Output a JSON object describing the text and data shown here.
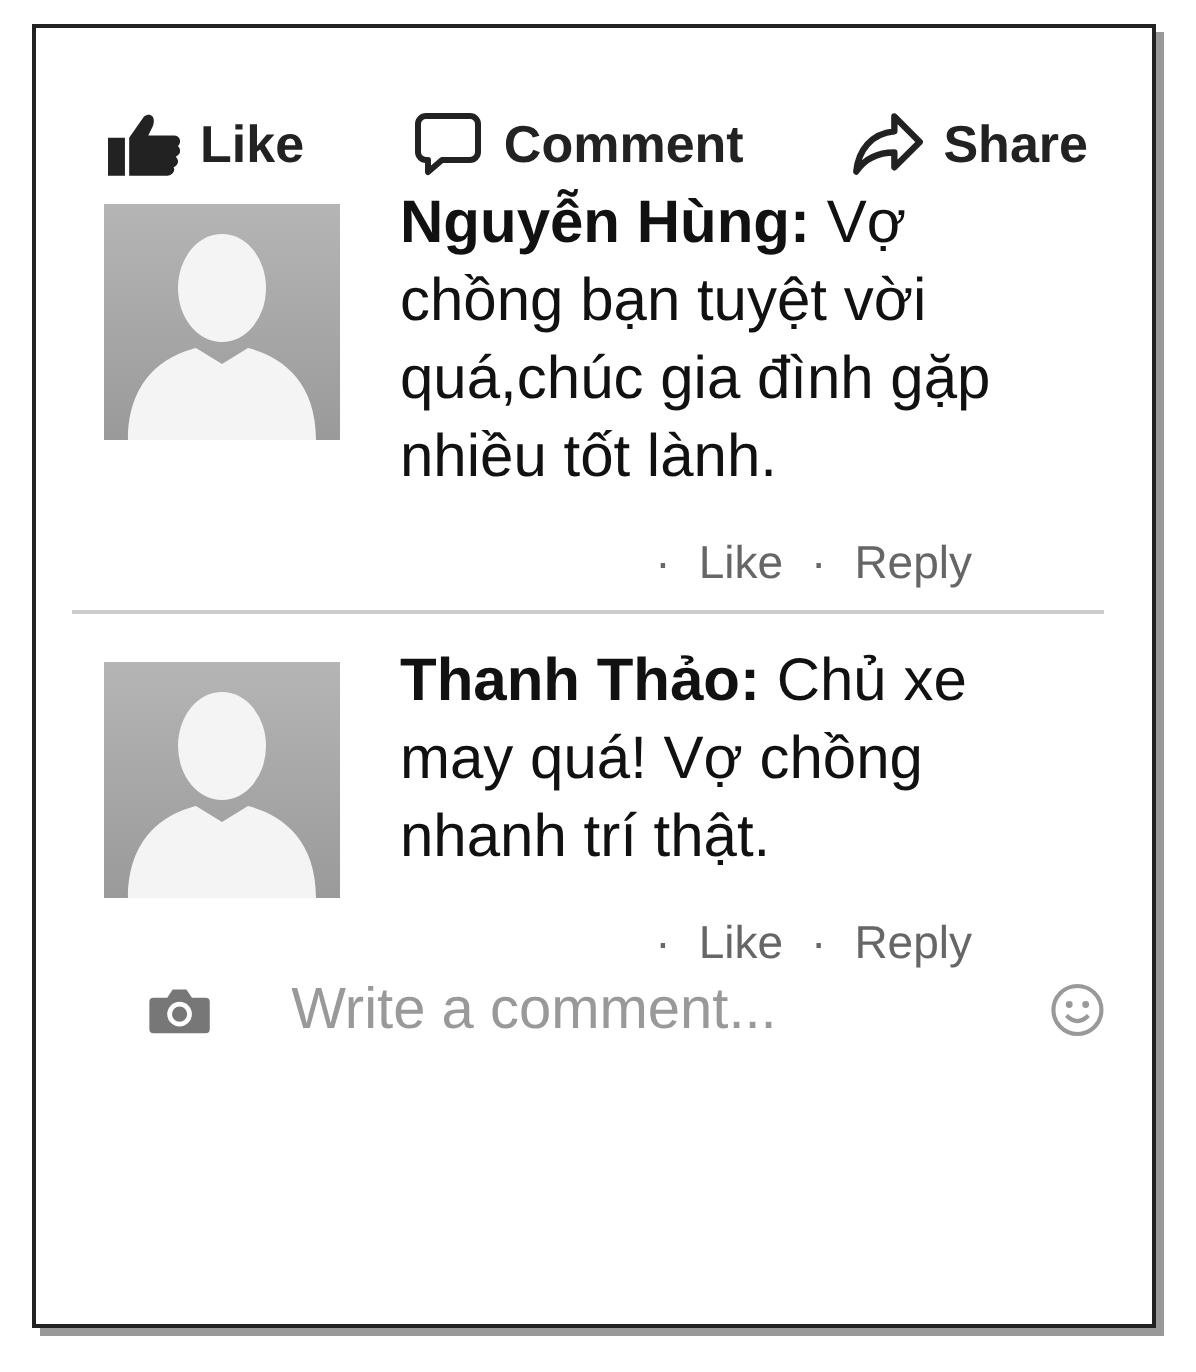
{
  "actions": [
    {
      "kind": "like",
      "label": "Like"
    },
    {
      "kind": "comment",
      "label": "Comment"
    },
    {
      "kind": "share",
      "label": "Share"
    }
  ],
  "comments": [
    {
      "text": "**Nguyễn Hùng:** Vợ chồng bạn tuyệt vời quá,chúc gia đình gặp nhiều tốt lành.",
      "links": [
        {
          "sep": "·",
          "label": "Like"
        },
        {
          "sep": "·",
          "label": "Reply"
        }
      ]
    },
    {
      "text": "**Thanh Thảo:** Chủ xe may quá! Vợ chồng nhanh trí thật.",
      "links": [
        {
          "sep": "·",
          "label": "Like"
        },
        {
          "sep": "·",
          "label": "Reply"
        }
      ]
    }
  ],
  "composer": {
    "placeholder": "Write a comment..."
  }
}
